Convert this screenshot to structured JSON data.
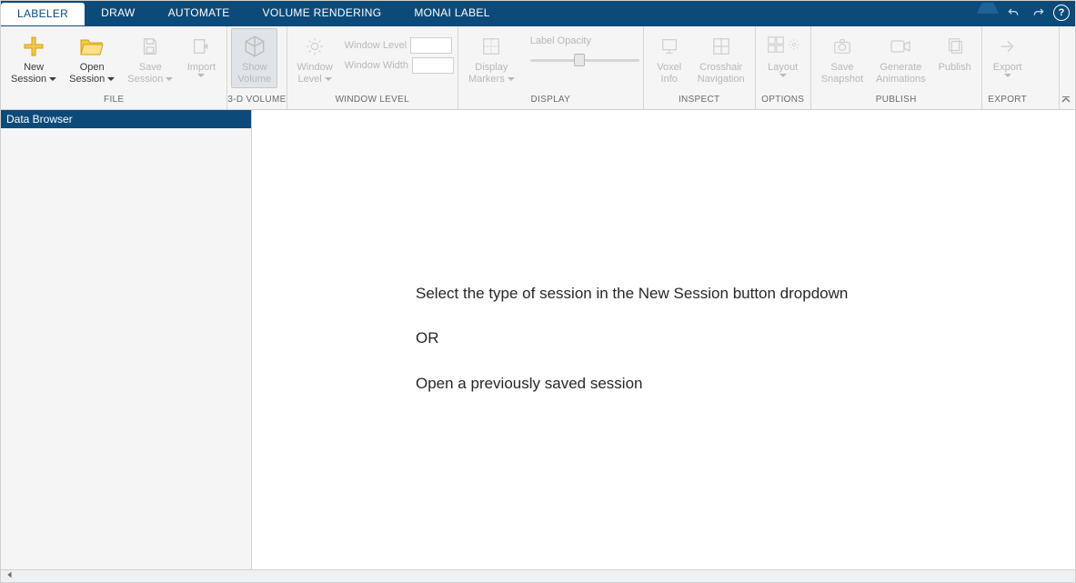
{
  "tabs": {
    "items": [
      "LABELER",
      "DRAW",
      "AUTOMATE",
      "VOLUME RENDERING",
      "MONAI LABEL"
    ],
    "active_index": 0
  },
  "ribbon": {
    "groups": {
      "file": {
        "label": "FILE",
        "new_session": {
          "l1": "New",
          "l2": "Session"
        },
        "open_session": {
          "l1": "Open",
          "l2": "Session"
        },
        "save_session": {
          "l1": "Save",
          "l2": "Session"
        },
        "import": {
          "l1": "Import",
          "l2": ""
        }
      },
      "volume3d": {
        "label": "3-D VOLUME",
        "show_volume": {
          "l1": "Show",
          "l2": "Volume"
        }
      },
      "window_level": {
        "label": "WINDOW LEVEL",
        "window_level_btn": {
          "l1": "Window",
          "l2": "Level"
        },
        "wl_level_label": "Window Level",
        "wl_width_label": "Window Width",
        "wl_level_value": "",
        "wl_width_value": ""
      },
      "display": {
        "label": "DISPLAY",
        "markers": {
          "l1": "Display",
          "l2": "Markers"
        },
        "opacity_label": "Label Opacity"
      },
      "inspect": {
        "label": "INSPECT",
        "voxel_info": {
          "l1": "Voxel",
          "l2": "Info"
        },
        "crosshair": {
          "l1": "Crosshair",
          "l2": "Navigation"
        }
      },
      "options": {
        "label": "OPTIONS",
        "layout": {
          "l1": "Layout",
          "l2": ""
        }
      },
      "publish": {
        "label": "PUBLISH",
        "snapshot": {
          "l1": "Save",
          "l2": "Snapshot"
        },
        "anim": {
          "l1": "Generate",
          "l2": "Animations"
        },
        "publish": {
          "l1": "Publish",
          "l2": ""
        }
      },
      "export": {
        "label": "EXPORT",
        "export": {
          "l1": "Export",
          "l2": ""
        }
      }
    }
  },
  "sidebar": {
    "title": "Data Browser"
  },
  "canvas": {
    "line1": "Select the type of session in the New Session button dropdown",
    "line2": "OR",
    "line3": "Open a previously saved session"
  }
}
